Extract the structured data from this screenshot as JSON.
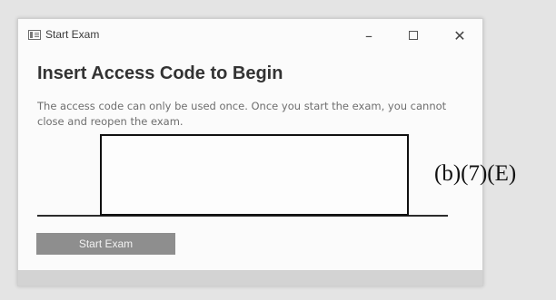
{
  "window": {
    "title": "Start Exam",
    "controls": {
      "minimize": "–",
      "close": "✕"
    }
  },
  "main": {
    "heading": "Insert Access Code to Begin",
    "description": "The access code can only be used once. Once you start the exam, you cannot close and reopen the exam.",
    "start_button": "Start Exam"
  },
  "redaction": {
    "label": "(b)(7)(E)"
  },
  "icons": {
    "app": "form-window-icon",
    "minimize": "minimize-icon",
    "maximize": "maximize-icon",
    "close": "close-icon"
  },
  "colors": {
    "background": "#e4e4e4",
    "window": "#fbfbfb",
    "button": "#8e8e8e",
    "underline": "#2b2b2b"
  }
}
